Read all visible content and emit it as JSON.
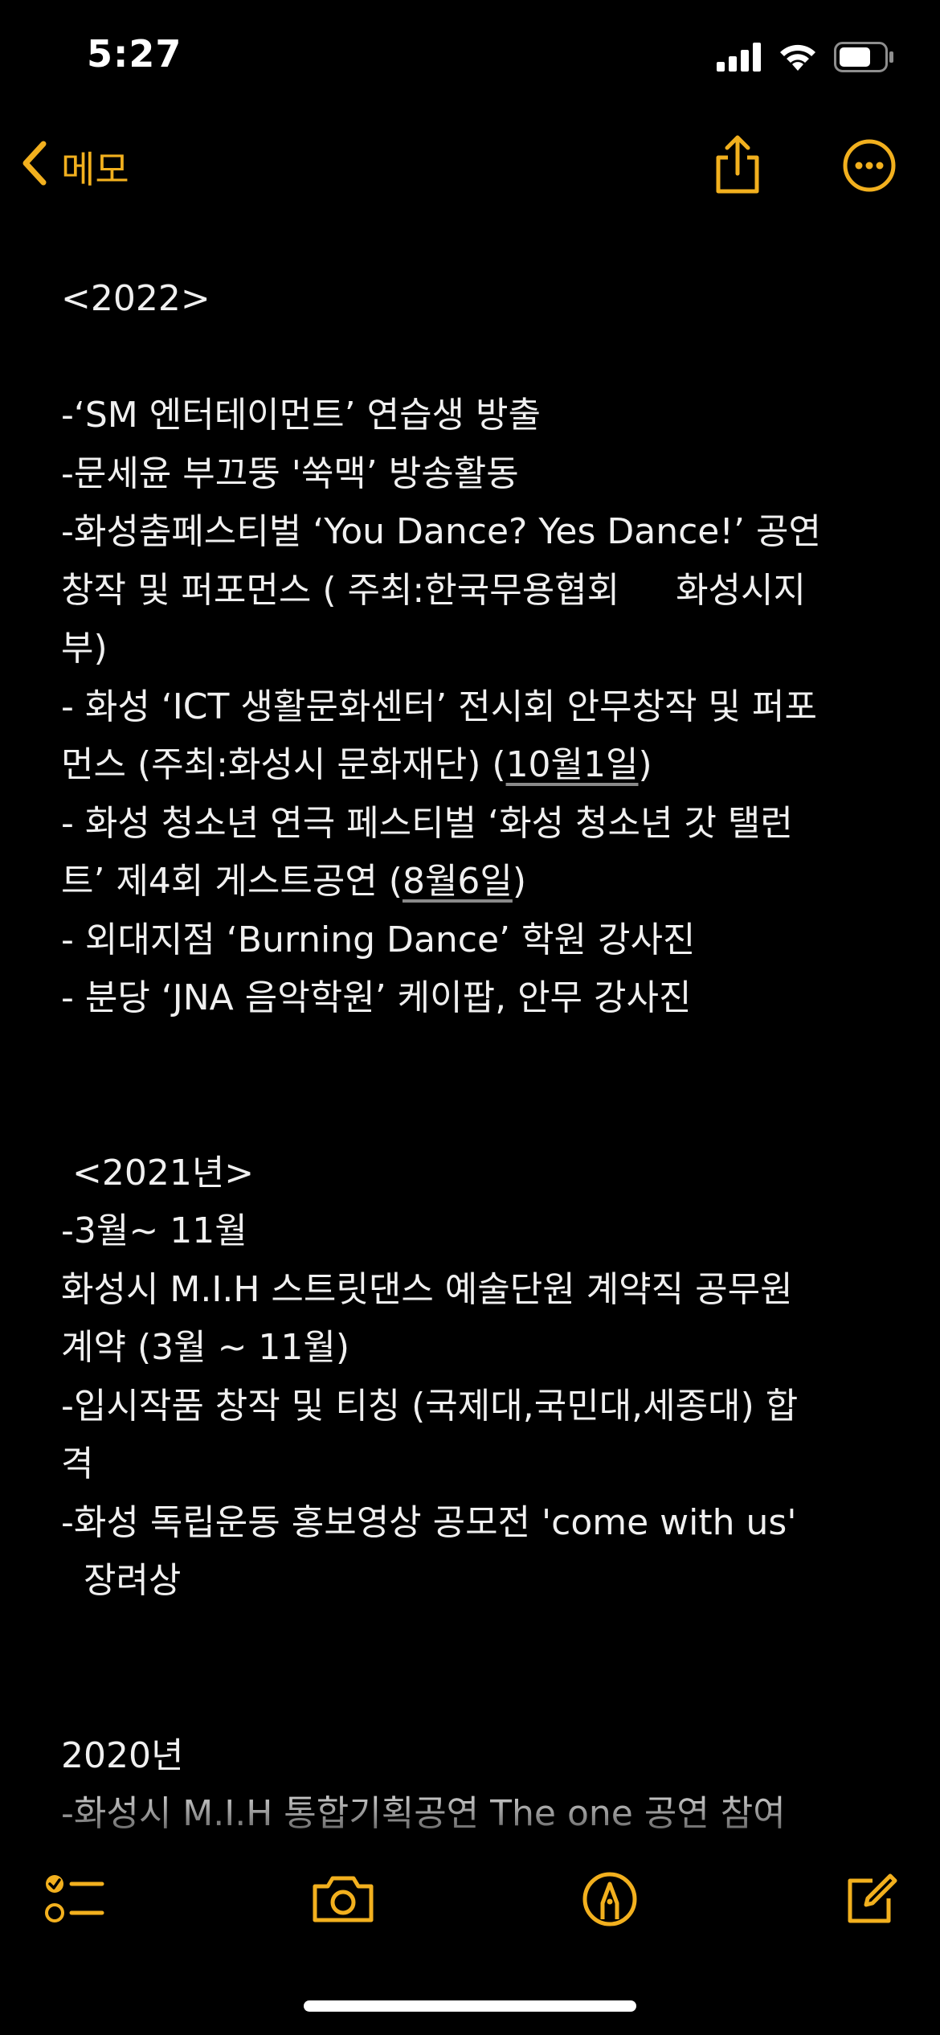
{
  "status_bar": {
    "time": "5:27",
    "icons": [
      "cellular-signal-icon",
      "wifi-icon",
      "battery-icon"
    ]
  },
  "nav": {
    "back_label": "메모",
    "back_icon": "chevron-left-icon",
    "share_icon": "share-icon",
    "more_icon": "more-options-icon"
  },
  "note": {
    "lines": [
      "<2022>",
      "",
      "-‘SM 엔터테이먼트’ 연습생 방출",
      "-문세윤 부끄뚱 '쑥맥’ 방송활동",
      "-화성춤페스티벌 ‘You Dance? Yes Dance!’ 공연",
      "창작 및 퍼포먼스 ( 주최:한국무용협회     화성시지",
      "부)",
      "- 화성 ‘ICT 생활문화센터’ 전시회 안무창작 및 퍼포",
      "먼스 (주최:화성시 문화재단) (10월1일)",
      "- 화성 청소년 연극 페스티벌 ‘화성 청소년 갓 탤런",
      "트’ 제4회 게스트공연 (8월6일)",
      "- 외대지점 ‘Burning Dance’ 학원 강사진",
      "- 분당 ‘JNA 음악학원’ 케이팝, 안무 강사진",
      "",
      "",
      " <2021년>",
      "-3월~ 11월",
      "화성시 M.I.H 스트릿댄스 예술단원 계약직 공무원",
      "계약 (3월 ~ 11월)",
      "-입시작품 창작 및 티칭 (국제대,국민대,세종대) 합",
      "격",
      "-화성 독립운동 홍보영상 공모전 'come with us'",
      "  장려상",
      "",
      "",
      "2020년",
      "-화성시 M.I.H 통합기획공연 The one 공연 참여"
    ],
    "underlined_dates": [
      "10월1일",
      "8월6일"
    ]
  },
  "toolbar": {
    "checklist_icon": "checklist-icon",
    "camera_icon": "camera-icon",
    "markup_icon": "markup-pen-icon",
    "compose_icon": "compose-icon"
  },
  "colors": {
    "accent": "#F2B01E",
    "background": "#000000",
    "text": "#F0F0F0"
  }
}
